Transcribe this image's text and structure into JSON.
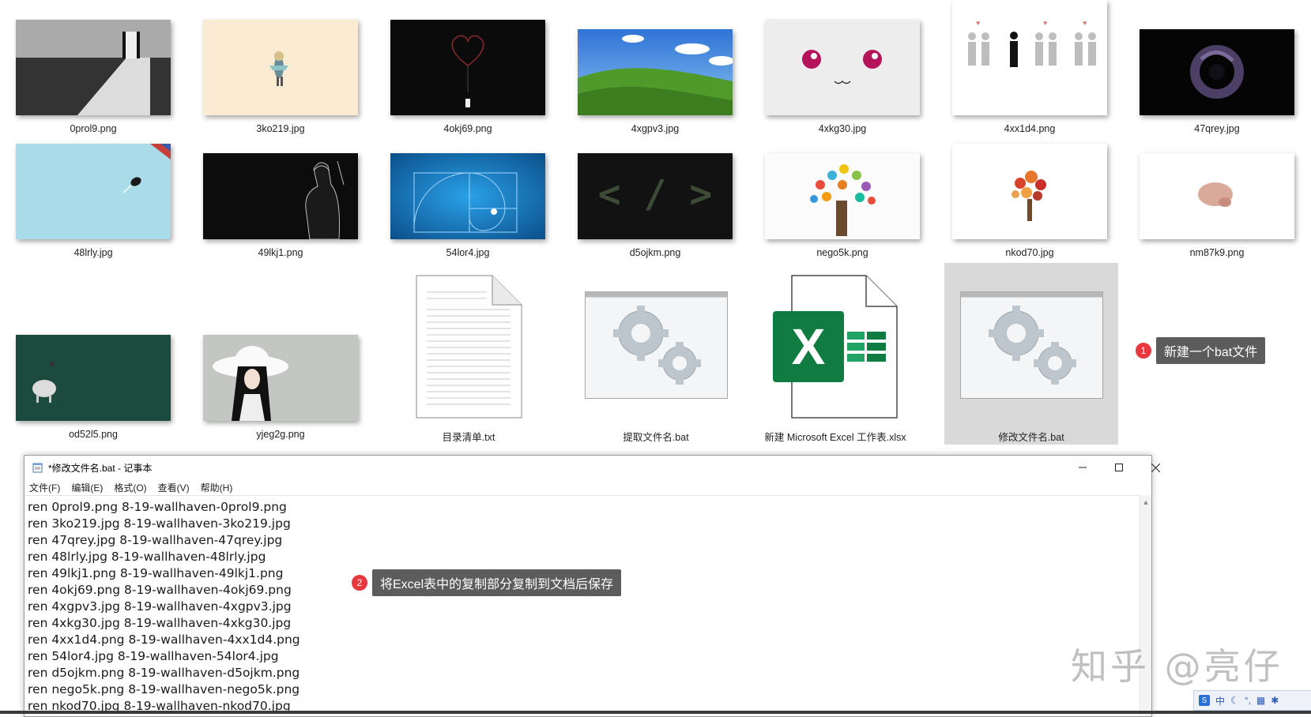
{
  "files": {
    "row1": [
      "0prol9.png",
      "3ko219.jpg",
      "4okj69.png",
      "4xgpv3.jpg",
      "4xkg30.jpg",
      "4xx1d4.png",
      "47qrey.jpg"
    ],
    "row2": [
      "48lrly.jpg",
      "49lkj1.png",
      "54lor4.jpg",
      "d5ojkm.png",
      "nego5k.png",
      "nkod70.jpg",
      "nm87k9.png"
    ],
    "row3": [
      "od52l5.png",
      "yjeg2g.png",
      "目录清单.txt",
      "提取文件名.bat",
      "新建 Microsoft Excel 工作表.xlsx",
      "修改文件名.bat"
    ]
  },
  "callout1": {
    "num": "1",
    "text": "新建一个bat文件"
  },
  "callout2": {
    "num": "2",
    "text": "将Excel表中的复制部分复制到文档后保存"
  },
  "notepad": {
    "title": "*修改文件名.bat - 记事本",
    "menu": [
      "文件(F)",
      "编辑(E)",
      "格式(O)",
      "查看(V)",
      "帮助(H)"
    ],
    "lines": [
      "ren 0prol9.png 8-19-wallhaven-0prol9.png",
      "ren 3ko219.jpg 8-19-wallhaven-3ko219.jpg",
      "ren 47qrey.jpg 8-19-wallhaven-47qrey.jpg",
      "ren 48lrly.jpg 8-19-wallhaven-48lrly.jpg",
      "ren 49lkj1.png 8-19-wallhaven-49lkj1.png",
      "ren 4okj69.png 8-19-wallhaven-4okj69.png",
      "ren 4xgpv3.jpg 8-19-wallhaven-4xgpv3.jpg",
      "ren 4xkg30.jpg 8-19-wallhaven-4xkg30.jpg",
      "ren 4xx1d4.png 8-19-wallhaven-4xx1d4.png",
      "ren 54lor4.jpg 8-19-wallhaven-54lor4.jpg",
      "ren d5ojkm.png 8-19-wallhaven-d5ojkm.png",
      "ren nego5k.png 8-19-wallhaven-nego5k.png",
      "ren nkod70.jpg 8-19-wallhaven-nkod70.jpg"
    ]
  },
  "watermark": "知乎 @亮仔",
  "ime": [
    "中"
  ]
}
